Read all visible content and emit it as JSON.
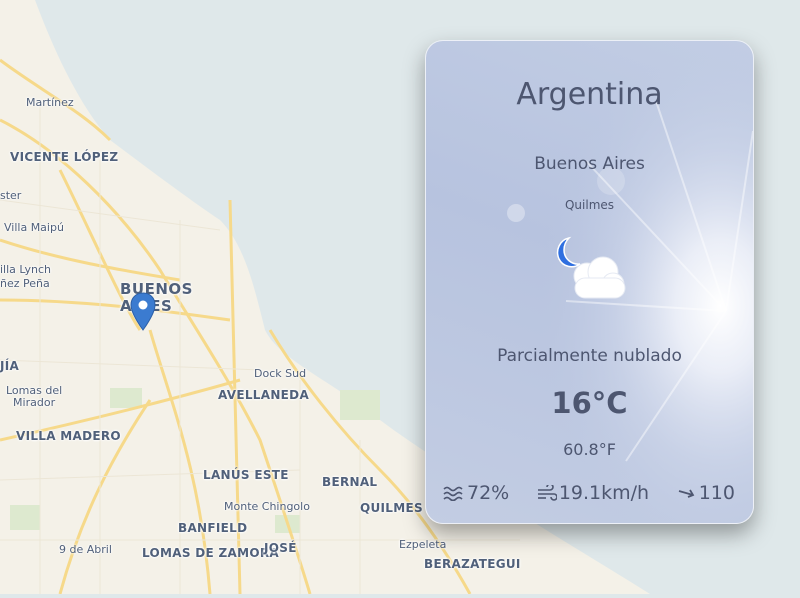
{
  "map": {
    "labels": {
      "martinez": "Martínez",
      "vicente_lopez": "VICENTE LÓPEZ",
      "ster": "ster",
      "villa_maipu": "Villa Maipú",
      "villa_lynch": "illa Lynch",
      "nez_pena": "ñez Peña",
      "buenos_aires": "BUENOS\nAIRES",
      "jia": "JÍA",
      "lomas_del_mirador": "Lomas del\nMirador",
      "villa_madero": "VILLA MADERO",
      "dock_sud": "Dock Sud",
      "avellaneda": "AVELLANEDA",
      "lanus_este": "LANÚS ESTE",
      "bernal": "BERNAL",
      "monte_chingolo": "Monte Chingolo",
      "quilmes": "QUILMES",
      "banfield": "BANFIELD",
      "nueve_de_abril": "9 de Abril",
      "lomas_de_zamora": "LOMAS DE ZAMORA",
      "jose": "JOSÉ",
      "ezpeleta": "Ezpeleta",
      "berazategui": "BERAZATEGUI"
    },
    "colors": {
      "water": "#dfe8ea",
      "land": "#f4f1e8",
      "road": "#f6d98a",
      "pin": "#3b7bd0"
    },
    "pin_icon": "map-marker-icon"
  },
  "weather": {
    "country": "Argentina",
    "city": "Buenos Aires",
    "district": "Quilmes",
    "condition": "Parcialmente nublado",
    "temp_c": "16°C",
    "temp_f": "60.8°F",
    "icon": "partly-cloudy-night-icon",
    "humidity": {
      "icon": "humidity-icon",
      "value": "72%"
    },
    "wind": {
      "icon": "wind-icon",
      "value": "19.1km/h"
    },
    "direction": {
      "icon": "wind-direction-icon",
      "value": "110"
    }
  }
}
